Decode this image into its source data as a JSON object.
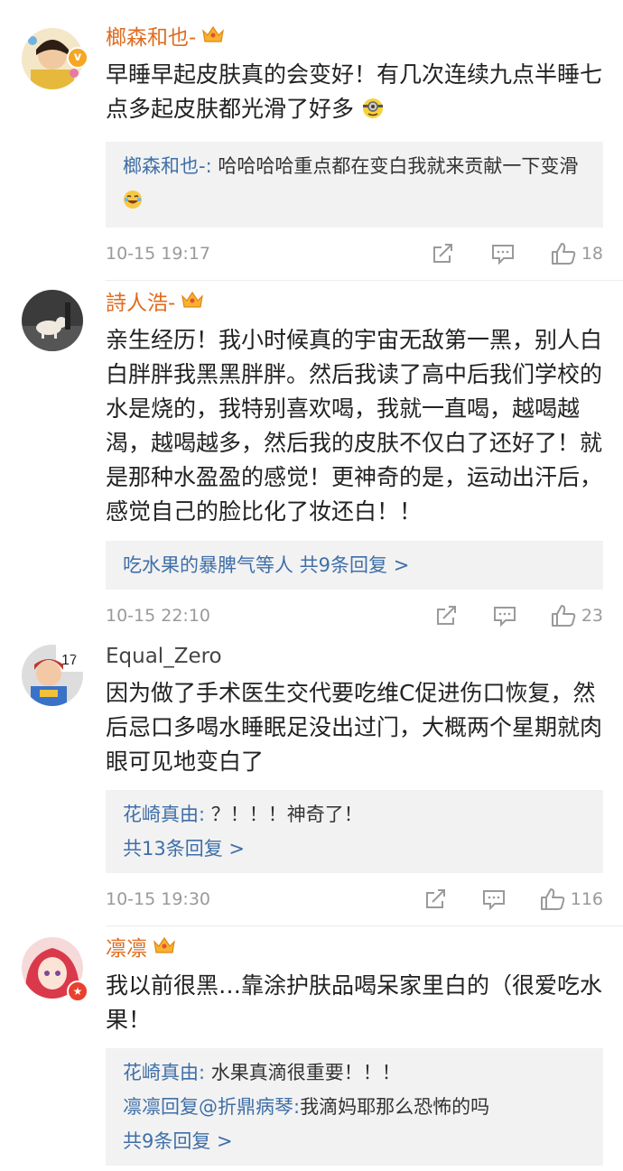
{
  "comments": [
    {
      "username": "榔森和也-",
      "text": "早睡早起皮肤真的会变好！有几次连续九点半睡七点多起皮肤都光滑了好多",
      "replies": [
        {
          "name": "榔森和也-:",
          "content": " 哈哈哈哈重点都在变白我就来贡献一下变滑"
        }
      ],
      "reply_more": "",
      "time": "10-15 19:17",
      "likes": "18"
    },
    {
      "username": "詩人浩-",
      "text": "亲生经历！我小时候真的宇宙无敌第一黑，别人白白胖胖我黑黑胖胖。然后我读了高中后我们学校的水是烧的，我特别喜欢喝，我就一直喝，越喝越渴，越喝越多，然后我的皮肤不仅白了还好了！就是那种水盈盈的感觉！更神奇的是，运动出汗后，感觉自己的脸比化了妆还白！！",
      "reply_prefix": "吃水果的暴脾气",
      "reply_suffix": "等人  共9条回复 >",
      "time": "10-15 22:10",
      "likes": "23"
    },
    {
      "username": "Equal_Zero",
      "text": "因为做了手术医生交代要吃维C促进伤口恢复，然后忌口多喝水睡眠足没出过门，大概两个星期就肉眼可见地变白了",
      "replies": [
        {
          "name": "花崎真由:",
          "content": " ？！！！神奇了！"
        }
      ],
      "reply_more": "共13条回复 >",
      "time": "10-15 19:30",
      "likes": "116"
    },
    {
      "username": "凛凛",
      "text": "我以前很黑…靠涂护肤品喝呆家里白的（很爱吃水果！",
      "replies": [
        {
          "name": "花崎真由:",
          "content": " 水果真滴很重要！！！"
        },
        {
          "name": "凛凛回复@折鼎病琴:",
          "content": "我滴妈耶那么恐怖的吗"
        }
      ],
      "reply_more": "共9条回复 >"
    }
  ]
}
